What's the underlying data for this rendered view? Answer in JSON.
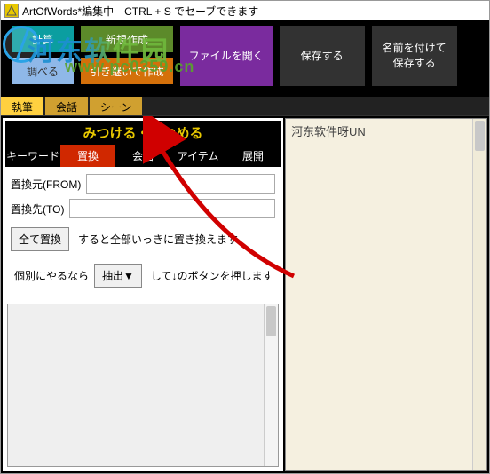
{
  "title": "ArtOfWords*編集中　CTRL + S でセーブできます",
  "watermark": {
    "text": "河东软件园",
    "url": "www.pc0359.cn"
  },
  "toolbar": {
    "calc": "計算",
    "investigate": "調べる",
    "new": "新規作成",
    "inherit": "引き継いで作成",
    "open": "ファイルを開く",
    "save": "保存する",
    "saveas1": "名前を付けて",
    "saveas2": "保存する"
  },
  "maintabs": {
    "t1": "執筆",
    "t2": "会話",
    "t3": "シーン"
  },
  "panel": {
    "title": "みつける・あつめる",
    "subtabs": {
      "keyword": "キーワード",
      "replace": "置換",
      "conv": "会話",
      "item": "アイテム",
      "expand": "展開"
    },
    "from_label": "置換元(FROM)",
    "to_label": "置換先(TO)",
    "replace_all": "全て置換",
    "hint1": "すると全部いっきに置き換えます。",
    "individual": "個別にやるなら",
    "extract": "抽出▼",
    "hint2": "して↓のボタンを押します"
  },
  "right": {
    "text": "河东软件呀UN"
  }
}
